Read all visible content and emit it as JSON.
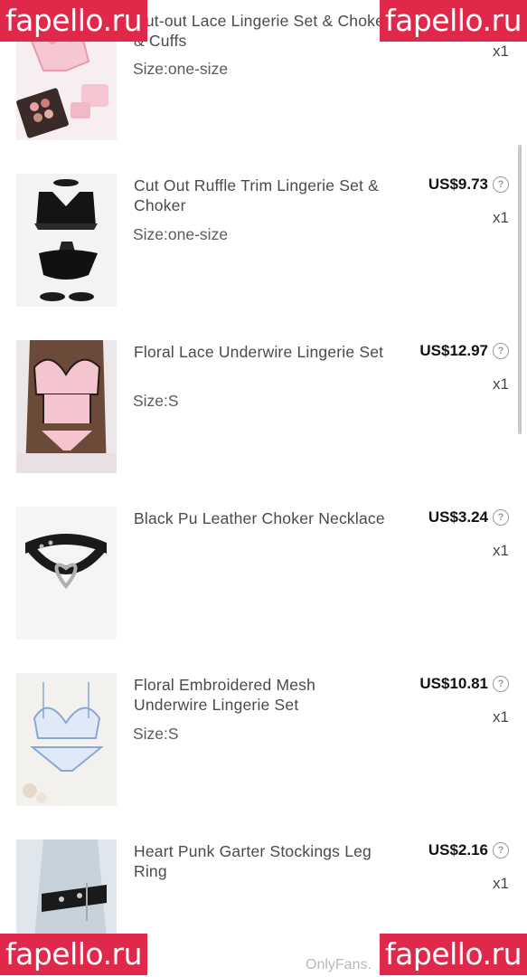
{
  "products": [
    {
      "title": "Cut-out Lace Lingerie Set & Choker & Cuffs",
      "size": "Size:one-size",
      "price": "",
      "qty": "x1",
      "thumb": "pink-lingerie-set-image"
    },
    {
      "title": "Cut Out Ruffle Trim Lingerie Set & Choker",
      "size": "Size:one-size",
      "price": "US$9.73",
      "qty": "x1",
      "thumb": "black-lingerie-set-image"
    },
    {
      "title": "Floral Lace Underwire Lingerie Set",
      "size": "Size:S",
      "price": "US$12.97",
      "qty": "x1",
      "thumb": "pink-lace-lingerie-image"
    },
    {
      "title": "Black Pu Leather Choker Necklace",
      "size": "",
      "price": "US$3.24",
      "qty": "x1",
      "thumb": "black-choker-image"
    },
    {
      "title": "Floral Embroidered Mesh Underwire Lingerie Set",
      "size": "Size:S",
      "price": "US$10.81",
      "qty": "x1",
      "thumb": "blue-mesh-lingerie-image"
    },
    {
      "title": "Heart Punk Garter Stockings Leg Ring",
      "size": "",
      "price": "US$2.16",
      "qty": "x1",
      "thumb": "leg-garter-image"
    }
  ],
  "help_glyph": "?",
  "watermark": "fapello.ru",
  "footer_brand": "OnlyFans.",
  "colors": {
    "watermark_bg": "#e0284a",
    "price_text": "#111111",
    "title_text": "#4a4a4a"
  }
}
